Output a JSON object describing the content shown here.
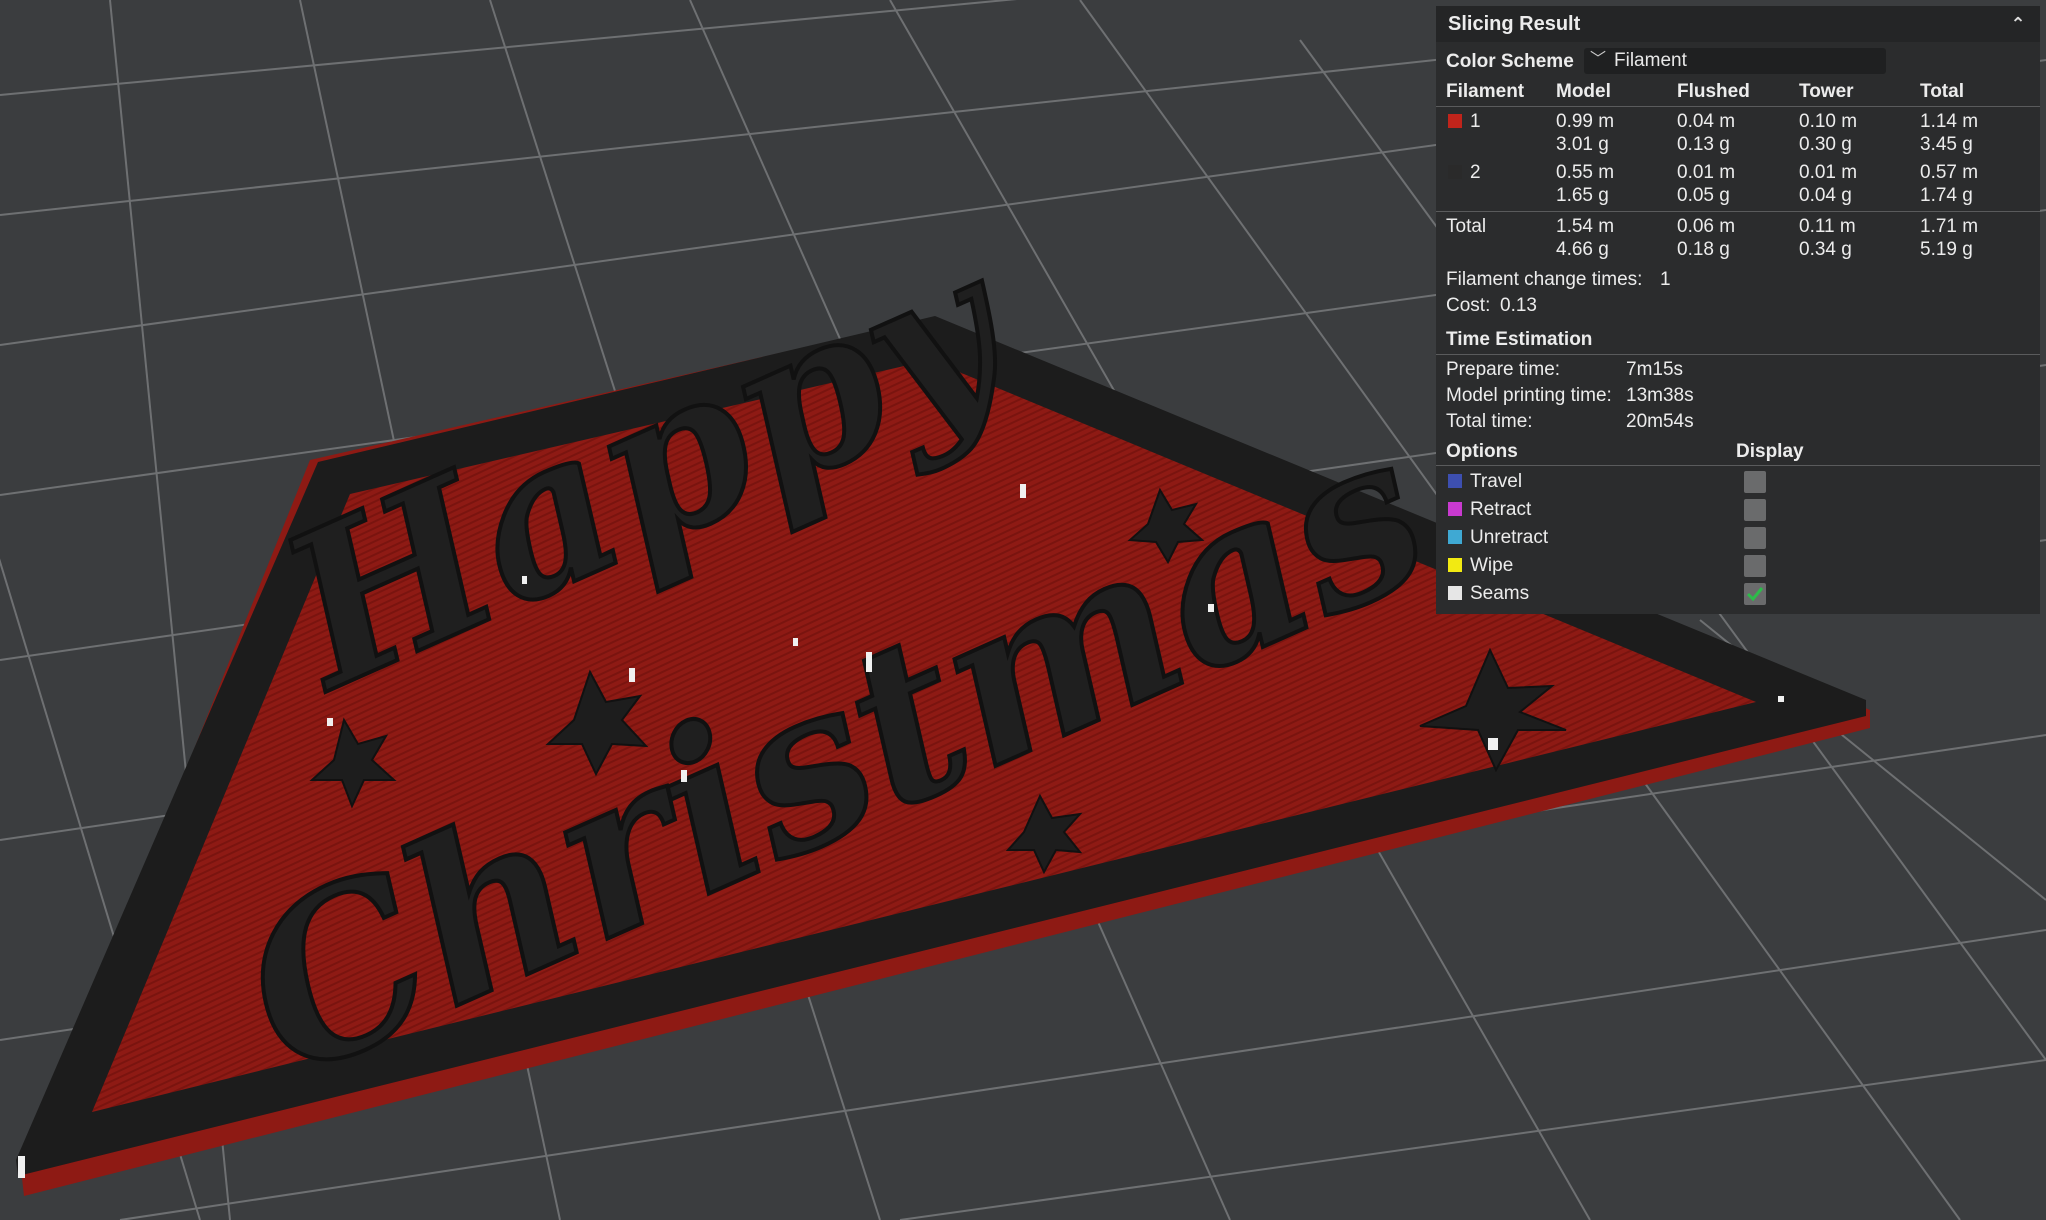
{
  "panel": {
    "title": "Slicing Result",
    "color_scheme_label": "Color Scheme",
    "color_scheme_value": "Filament",
    "table": {
      "headers": [
        "Filament",
        "Model",
        "Flushed",
        "Tower",
        "Total"
      ],
      "rows": [
        {
          "id": "1",
          "color": "#c0241b",
          "model": [
            "0.99 m",
            "3.01 g"
          ],
          "flushed": [
            "0.04 m",
            "0.13 g"
          ],
          "tower": [
            "0.10 m",
            "0.30 g"
          ],
          "total": [
            "1.14 m",
            "3.45 g"
          ]
        },
        {
          "id": "2",
          "color": "#2a2a2a",
          "model": [
            "0.55 m",
            "1.65 g"
          ],
          "flushed": [
            "0.01 m",
            "0.05 g"
          ],
          "tower": [
            "0.01 m",
            "0.04 g"
          ],
          "total": [
            "0.57 m",
            "1.74 g"
          ]
        }
      ],
      "total": {
        "label": "Total",
        "model": [
          "1.54 m",
          "4.66 g"
        ],
        "flushed": [
          "0.06 m",
          "0.18 g"
        ],
        "tower": [
          "0.11 m",
          "0.34 g"
        ],
        "total": [
          "1.71 m",
          "5.19 g"
        ]
      }
    },
    "filament_change_label": "Filament change times:",
    "filament_change_value": "1",
    "cost_label": "Cost:",
    "cost_value": "0.13",
    "time": {
      "title": "Time Estimation",
      "prepare_label": "Prepare time:",
      "prepare_value": "7m15s",
      "model_label": "Model printing time:",
      "model_value": "13m38s",
      "total_label": "Total time:",
      "total_value": "20m54s"
    },
    "options": {
      "title": "Options",
      "display_title": "Display",
      "items": [
        {
          "label": "Travel",
          "color": "#3d4fb0",
          "checked": false
        },
        {
          "label": "Retract",
          "color": "#c93ad0",
          "checked": false
        },
        {
          "label": "Unretract",
          "color": "#3fa9d3",
          "checked": false
        },
        {
          "label": "Wipe",
          "color": "#f2ea12",
          "checked": false
        },
        {
          "label": "Seams",
          "color": "#e6e6e6",
          "checked": true
        }
      ]
    }
  },
  "scene": {
    "text_line1": "Happy",
    "text_line2": "Christmas",
    "plate_color": "#8e1a14",
    "border_color": "#1c1c1c",
    "grid_color": "#6b6d6f"
  }
}
